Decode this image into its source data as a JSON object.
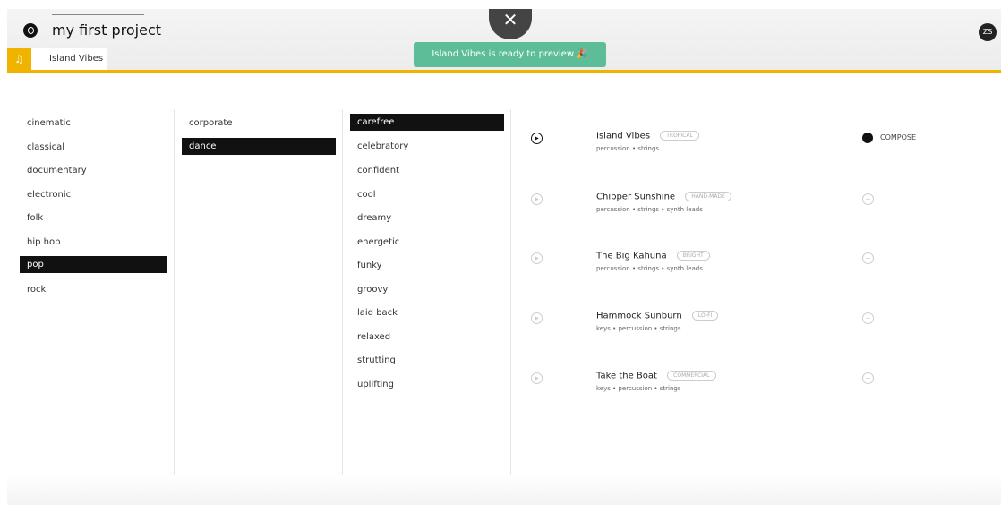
{
  "project": {
    "title": "my first project"
  },
  "tab": {
    "label": "Island Vibes"
  },
  "toast": {
    "text": "Island Vibes is ready to preview 🎉"
  },
  "user": {
    "initials": "ZS"
  },
  "colors": {
    "accent": "#f0b400",
    "toast": "#5dbd98",
    "selected": "#111111"
  },
  "genres": [
    "cinematic",
    "classical",
    "documentary",
    "electronic",
    "folk",
    "hip hop",
    "pop",
    "rock"
  ],
  "selected_genre": "pop",
  "subgenres": [
    "corporate",
    "dance"
  ],
  "selected_subgenre": "dance",
  "moods": [
    "carefree",
    "celebratory",
    "confident",
    "cool",
    "dreamy",
    "energetic",
    "funky",
    "groovy",
    "laid back",
    "relaxed",
    "strutting",
    "uplifting"
  ],
  "selected_mood": "carefree",
  "compose_label": "COMPOSE",
  "tracks": [
    {
      "title": "Island Vibes",
      "badge": "TROPICAL",
      "tags": "percussion • strings"
    },
    {
      "title": "Chipper Sunshine",
      "badge": "HAND-MADE",
      "tags": "percussion • strings • synth leads"
    },
    {
      "title": "The Big Kahuna",
      "badge": "BRIGHT",
      "tags": "percussion • strings • synth leads"
    },
    {
      "title": "Hammock Sunburn",
      "badge": "LO-FI",
      "tags": "keys • percussion • strings"
    },
    {
      "title": "Take the Boat",
      "badge": "COMMERCIAL",
      "tags": "keys • percussion • strings"
    }
  ]
}
